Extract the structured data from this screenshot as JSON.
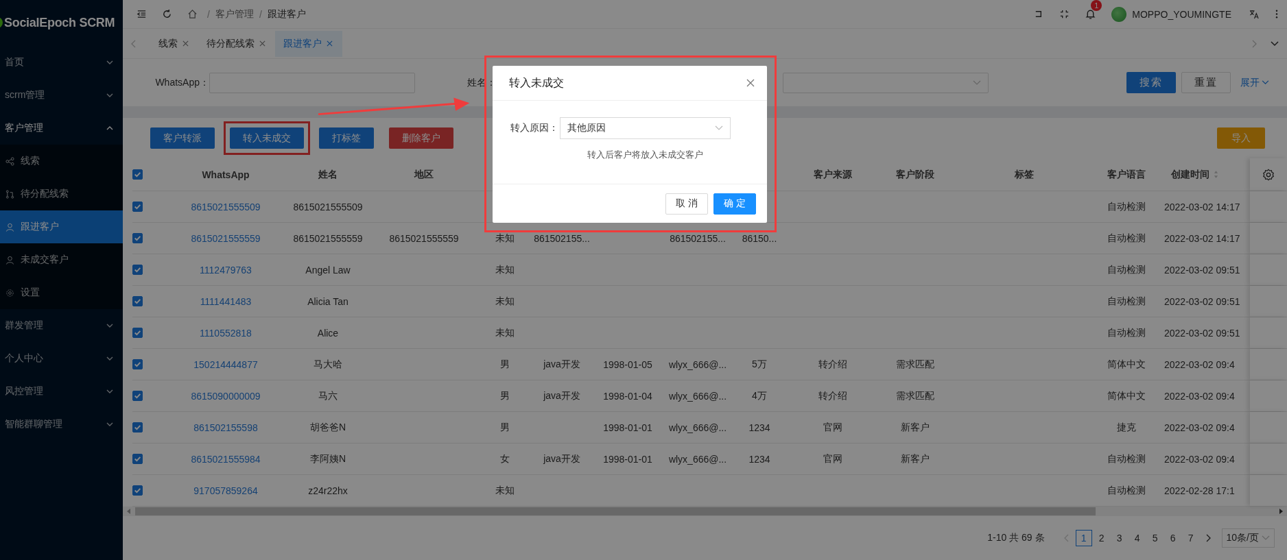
{
  "sidebar": {
    "logo": "SocialEpoch SCRM",
    "menu": [
      {
        "label": "首页",
        "expanded": false
      },
      {
        "label": "scrm管理",
        "expanded": false
      },
      {
        "label": "客户管理",
        "expanded": true,
        "children": [
          {
            "label": "线索",
            "selected": false
          },
          {
            "label": "待分配线索",
            "selected": false
          },
          {
            "label": "跟进客户",
            "selected": true
          },
          {
            "label": "未成交客户",
            "selected": false
          },
          {
            "label": "设置",
            "selected": false
          }
        ]
      },
      {
        "label": "群发管理",
        "expanded": false
      },
      {
        "label": "个人中心",
        "expanded": false
      },
      {
        "label": "风控管理",
        "expanded": false
      },
      {
        "label": "智能群聊管理",
        "expanded": false
      }
    ]
  },
  "header": {
    "breadcrumb_separator": "/",
    "breadcrumb": [
      "客户管理",
      "跟进客户"
    ],
    "notification_count": "1",
    "user": "MOPPO_YOUMINGTE"
  },
  "tabs": [
    {
      "label": "线索",
      "selected": false
    },
    {
      "label": "待分配线索",
      "selected": false
    },
    {
      "label": "跟进客户",
      "selected": true
    }
  ],
  "search": {
    "fields": [
      {
        "label": "WhatsApp：",
        "kind": "input"
      },
      {
        "label": "姓名：",
        "kind": "covered"
      },
      {
        "kind": "select"
      }
    ],
    "buttons": [
      {
        "label": "搜索",
        "kind": "primary"
      },
      {
        "label": "重置",
        "kind": "default"
      },
      {
        "label": "展开",
        "kind": "link"
      }
    ]
  },
  "actions": [
    {
      "label": "客户转派",
      "kind": "primary",
      "highlighted": false
    },
    {
      "label": "转入未成交",
      "kind": "primary",
      "highlighted": true
    },
    {
      "label": "打标签",
      "kind": "primary",
      "highlighted": false
    },
    {
      "label": "删除客户",
      "kind": "danger",
      "highlighted": false
    },
    {
      "label": "导入",
      "kind": "warning",
      "highlighted": false
    }
  ],
  "table": {
    "all_selected": true,
    "columns": [
      "WhatsApp",
      "姓名",
      "地区",
      null,
      null,
      null,
      null,
      null,
      "客户来源",
      "客户阶段",
      "标签",
      "客户语言",
      "创建时间"
    ],
    "rows": [
      {
        "selected": true,
        "cells": [
          "8615021555509",
          "8615021555509",
          null,
          null,
          null,
          null,
          null,
          null,
          null,
          null,
          null,
          "自动检测",
          "2022-03-02 14:17"
        ]
      },
      {
        "selected": true,
        "cells": [
          "8615021555559",
          "8615021555559",
          "8615021555559",
          "未知",
          "861502155...",
          null,
          "861502155...",
          "86150...",
          null,
          null,
          null,
          "自动检测",
          "2022-03-02 14:17"
        ]
      },
      {
        "selected": true,
        "cells": [
          "1112479763",
          "Angel Law",
          null,
          "未知",
          null,
          null,
          null,
          null,
          null,
          null,
          null,
          "自动检测",
          "2022-03-02 09:51"
        ]
      },
      {
        "selected": true,
        "cells": [
          "1111441483",
          "Alicia Tan",
          null,
          "未知",
          null,
          null,
          null,
          null,
          null,
          null,
          null,
          "自动检测",
          "2022-03-02 09:51"
        ]
      },
      {
        "selected": true,
        "cells": [
          "1110552818",
          "Alice",
          null,
          "未知",
          null,
          null,
          null,
          null,
          null,
          null,
          null,
          "自动检测",
          "2022-03-02 09:51"
        ]
      },
      {
        "selected": true,
        "cells": [
          "150214444877",
          "马大哈",
          null,
          "男",
          "java开发",
          "1998-01-05",
          "wlyx_666@...",
          "5万",
          "转介绍",
          "需求匹配",
          null,
          "简体中文",
          "2022-03-02 09:4"
        ]
      },
      {
        "selected": true,
        "cells": [
          "8615090000009",
          "马六",
          null,
          "男",
          "java开发",
          "1998-01-04",
          "wlyx_666@...",
          "4万",
          "转介绍",
          "需求匹配",
          null,
          "简体中文",
          "2022-03-02 09:4"
        ]
      },
      {
        "selected": true,
        "cells": [
          "861502155598",
          "胡爸爸N",
          null,
          "男",
          null,
          "1998-01-01",
          "wlyx_666@...",
          "1234",
          "官网",
          "新客户",
          null,
          "捷克",
          "2022-03-02 09:4"
        ]
      },
      {
        "selected": true,
        "cells": [
          "8615021555984",
          "李阿姨N",
          null,
          "女",
          "java开发",
          "1998-01-01",
          "wlyx_666@...",
          "1234",
          "官网",
          "新客户",
          null,
          "自动检测",
          "2022-03-02 09:4"
        ]
      },
      {
        "selected": true,
        "cells": [
          "917057859264",
          "z24r22hx",
          null,
          "未知",
          null,
          null,
          null,
          null,
          null,
          null,
          null,
          "自动检测",
          "2022-02-28 17:1"
        ]
      }
    ]
  },
  "pagination": {
    "summary": "1-10 共 69 条",
    "pages": [
      {
        "label": "1",
        "selected": true
      },
      {
        "label": "2",
        "selected": false
      },
      {
        "label": "3",
        "selected": false
      },
      {
        "label": "4",
        "selected": false
      },
      {
        "label": "5",
        "selected": false
      },
      {
        "label": "6",
        "selected": false
      },
      {
        "label": "7",
        "selected": false
      }
    ],
    "page_size": "10条/页"
  },
  "dialog": {
    "title": "转入未成交",
    "highlighted": true,
    "field_label": "转入原因：",
    "value": "其他原因",
    "hint": "转入后客户将放入未成交客户",
    "buttons": [
      {
        "label": "取 消",
        "kind": "default"
      },
      {
        "label": "确 定",
        "kind": "primary"
      }
    ]
  }
}
